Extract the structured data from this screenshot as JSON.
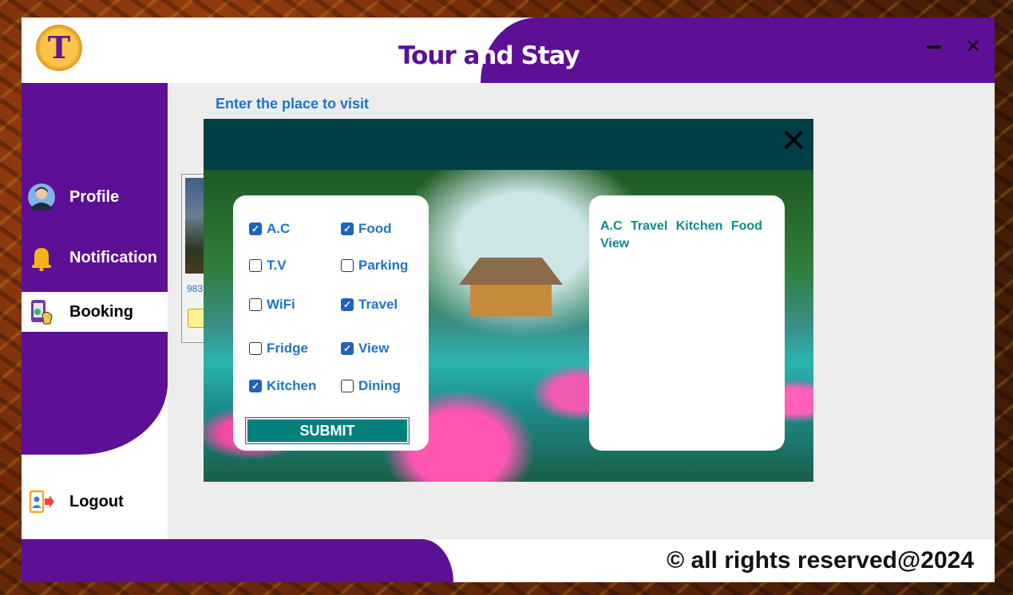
{
  "header": {
    "title": "Tour and Stay",
    "logo_letter": "T"
  },
  "sidebar": {
    "items": [
      {
        "label": "Profile"
      },
      {
        "label": "Notification"
      },
      {
        "label": "Booking"
      },
      {
        "label": "Logout"
      }
    ]
  },
  "main": {
    "place_label": "Enter the place to visit",
    "card_number": "983"
  },
  "modal": {
    "options": [
      {
        "label": "A.C",
        "checked": true
      },
      {
        "label": "Food",
        "checked": true
      },
      {
        "label": "T.V",
        "checked": false
      },
      {
        "label": "Parking",
        "checked": false
      },
      {
        "label": "WiFi",
        "checked": false
      },
      {
        "label": "Travel",
        "checked": true
      },
      {
        "label": "Fridge",
        "checked": false
      },
      {
        "label": "View",
        "checked": true
      },
      {
        "label": "Kitchen",
        "checked": true
      },
      {
        "label": "Dining",
        "checked": false
      }
    ],
    "submit_label": "SUBMIT",
    "selected_text": "A.C Travel Kitchen Food View"
  },
  "footer": {
    "copyright": "© all rights reserved@2024"
  },
  "colors": {
    "brand_purple": "#5d0f95",
    "teal": "#04807d",
    "link_blue": "#1f74c6"
  }
}
